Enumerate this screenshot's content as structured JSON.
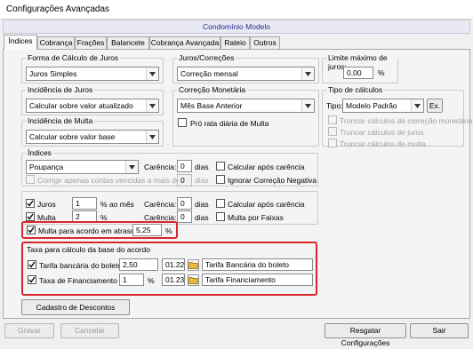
{
  "window": {
    "title": "Configurações Avançadas"
  },
  "subheader": "Condomínio Modelo",
  "tabs": [
    "Índices",
    "Cobrança",
    "Frações",
    "Balancete",
    "Cobrança Avançada",
    "Rateio",
    "Outros"
  ],
  "forma_calculo_juros": {
    "legend": "Forma de Cálculo de Juros",
    "value": "Juros Simples"
  },
  "incidencia_juros": {
    "legend": "Incidência de Juros",
    "value": "Calcular sobre valor atualizado"
  },
  "incidencia_multa": {
    "legend": "Incidência de Multa",
    "value": "Calcular sobre valor base"
  },
  "juros_correcoes": {
    "legend": "Juros/Correções",
    "value": "Correção mensal"
  },
  "correcao_monetaria": {
    "legend": "Correção Monetária",
    "value": "Mês Base Anterior",
    "pro_rata_label": "Pró rata diária de Multa"
  },
  "limite_juros": {
    "legend": "Limite máximo de juros:",
    "value": "0,00",
    "unit": "%"
  },
  "tipo_calculos": {
    "legend": "Tipo de cálculos",
    "tipo_label": "Tipo:",
    "tipo_value": "Modelo Padrão",
    "ex_button": "Ex.",
    "truncar_correcao": "Truncar cálculos de correção monetária",
    "truncar_juros": "Truncar cálculos de juros",
    "truncar_multa": "Truncar cálculos de multa"
  },
  "indices": {
    "legend": "Índices",
    "value": "Poupança",
    "carencia_label": "Carência:",
    "carencia_value": "0",
    "dias": "dias",
    "calcular_apos_carencia": "Calcular após carência",
    "ignorar_correcao_negativa": "Ignorar Correção Negativa",
    "corrigir_apenas": "Corrigir apenas contas vencidas a mais de",
    "corrigir_value": "0",
    "corrigir_dias": "dias"
  },
  "juros": {
    "label": "Juros",
    "value": "1",
    "unit": "% ao mês",
    "carencia_label": "Carência:",
    "carencia_value": "0",
    "dias": "dias",
    "calcular_apos_carencia": "Calcular após carência"
  },
  "multa": {
    "label": "Multa",
    "value": "2",
    "unit": "%",
    "carencia_label": "Carência:",
    "carencia_value": "0",
    "dias": "dias",
    "multa_por_faixas": "Multa por Faixas"
  },
  "multa_atraso": {
    "label": "Multa para acordo em atraso",
    "value": "5,25",
    "unit": "%"
  },
  "taxa_acordo": {
    "legend": "Taxa para cálculo da base do acordo",
    "tarifa_label": "Tarifa bancária do boleto",
    "tarifa_value": "2,50",
    "tarifa_code": "01.22",
    "tarifa_desc": "Tarifa Bancária do boleto",
    "financ_label": "Taxa de Financiamento",
    "financ_value": "1",
    "financ_unit": "%",
    "financ_code": "01.23",
    "financ_desc": "Tarifa Financiamento"
  },
  "buttons": {
    "cadastro_descontos": "Cadastro de Descontos",
    "gravar": "Gravar",
    "cancelar": "Cancelar",
    "resgatar": "Resgatar Configurações",
    "sair": "Sair"
  },
  "colors": {
    "highlight": "#d9262c",
    "folder": "#e8b93a"
  }
}
